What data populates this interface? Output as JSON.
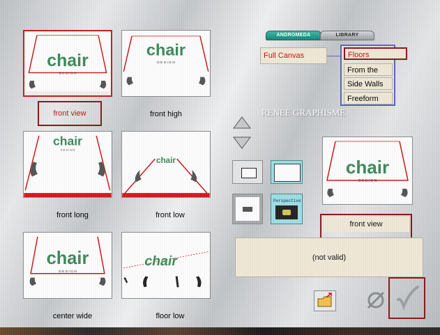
{
  "thumbnails": [
    {
      "label": "front view",
      "selected": true
    },
    {
      "label": "front high",
      "selected": false
    },
    {
      "label": "front long",
      "selected": false
    },
    {
      "label": "front low",
      "selected": false
    },
    {
      "label": "center wide",
      "selected": false
    },
    {
      "label": "floor low",
      "selected": false
    }
  ],
  "thumb_text": {
    "logo": "chair",
    "sub": "D E S I G N"
  },
  "tabs": {
    "left": "ANDROMEDA",
    "right": "LIBRARY"
  },
  "scope_field": "Full Canvas",
  "menu": {
    "items": [
      {
        "label": "Floors",
        "selected": true
      },
      {
        "label": "From the Top",
        "selected": false
      },
      {
        "label": "Side Walls",
        "selected": false
      },
      {
        "label": "Freeform",
        "selected": false
      }
    ]
  },
  "watermark": "RENEE GRAPHISME",
  "mode_buttons": {
    "perspective_label": "Perspective"
  },
  "preview": {
    "label": "front view"
  },
  "status": "(not valid)",
  "colors": {
    "accent_red": "#c81a1a",
    "highlight_border": "#8b1616",
    "logo_green": "#3c8a5a",
    "menu_border": "#5a66b8",
    "field_beige": "#f1ead9"
  }
}
